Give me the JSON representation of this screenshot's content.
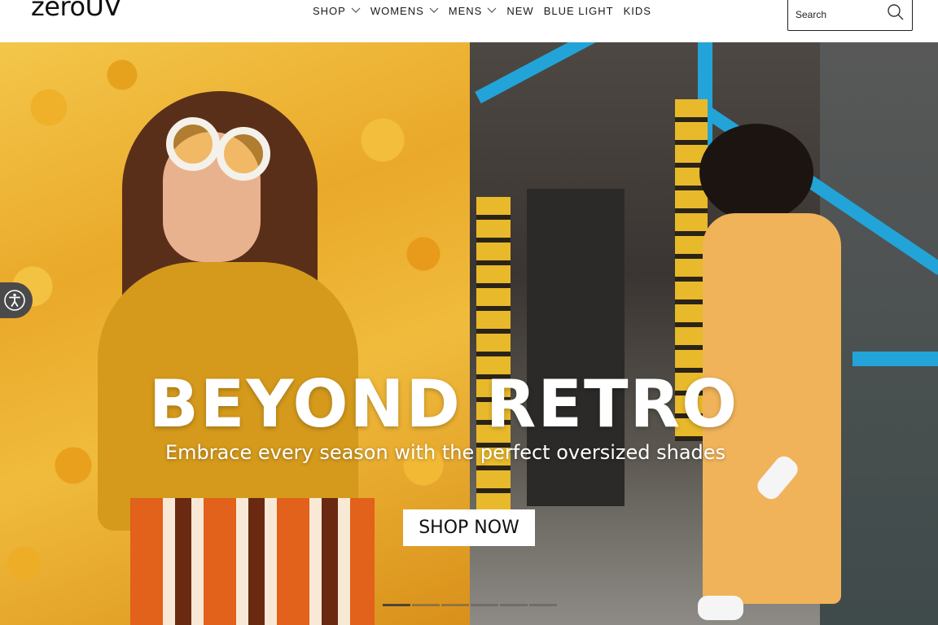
{
  "brand": {
    "logo_text": "zeroUV"
  },
  "nav": {
    "items": [
      {
        "label": "SHOP",
        "has_dropdown": true
      },
      {
        "label": "WOMENS",
        "has_dropdown": true
      },
      {
        "label": "MENS",
        "has_dropdown": true
      },
      {
        "label": "NEW",
        "has_dropdown": false
      },
      {
        "label": "BLUE LIGHT",
        "has_dropdown": false
      },
      {
        "label": "KIDS",
        "has_dropdown": false
      }
    ]
  },
  "search": {
    "placeholder": "Search",
    "value": "",
    "icon": "search-icon"
  },
  "hero": {
    "title": "BEYOND RETRO",
    "subtitle": "Embrace every season with the perfect oversized shades",
    "cta_label": "SHOP NOW",
    "slide_count": 6,
    "active_slide": 1
  },
  "accessibility": {
    "icon": "accessibility-icon"
  },
  "colors": {
    "text_primary": "#111111",
    "background": "#ffffff",
    "hero_text": "#ffffff",
    "left_panel": "#eaa92a",
    "accent_blue": "#22a4d8"
  }
}
